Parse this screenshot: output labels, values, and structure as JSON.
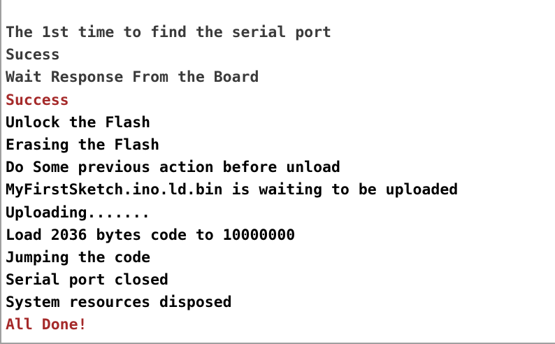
{
  "colors": {
    "normal": "#000000",
    "gray": "#3a3a3a",
    "highlight": "#a52a2a"
  },
  "log": {
    "lines": [
      {
        "text": "The 1st time to find the serial port",
        "style": "gray"
      },
      {
        "text": "Sucess",
        "style": "gray"
      },
      {
        "text": "Wait Response From the Board",
        "style": "gray"
      },
      {
        "text": "Success",
        "style": "red"
      },
      {
        "text": "Unlock the Flash",
        "style": "normal"
      },
      {
        "text": "Erasing the Flash",
        "style": "normal"
      },
      {
        "text": "Do Some previous action before unload",
        "style": "normal"
      },
      {
        "text": "MyFirstSketch.ino.ld.bin is waiting to be uploaded",
        "style": "normal"
      },
      {
        "text": "Uploading.......",
        "style": "normal"
      },
      {
        "text": "Load 2036 bytes code to 10000000",
        "style": "normal"
      },
      {
        "text": "Jumping the code",
        "style": "normal"
      },
      {
        "text": "Serial port closed",
        "style": "normal"
      },
      {
        "text": "System resources disposed",
        "style": "normal"
      },
      {
        "text": "All Done!",
        "style": "red"
      }
    ]
  }
}
